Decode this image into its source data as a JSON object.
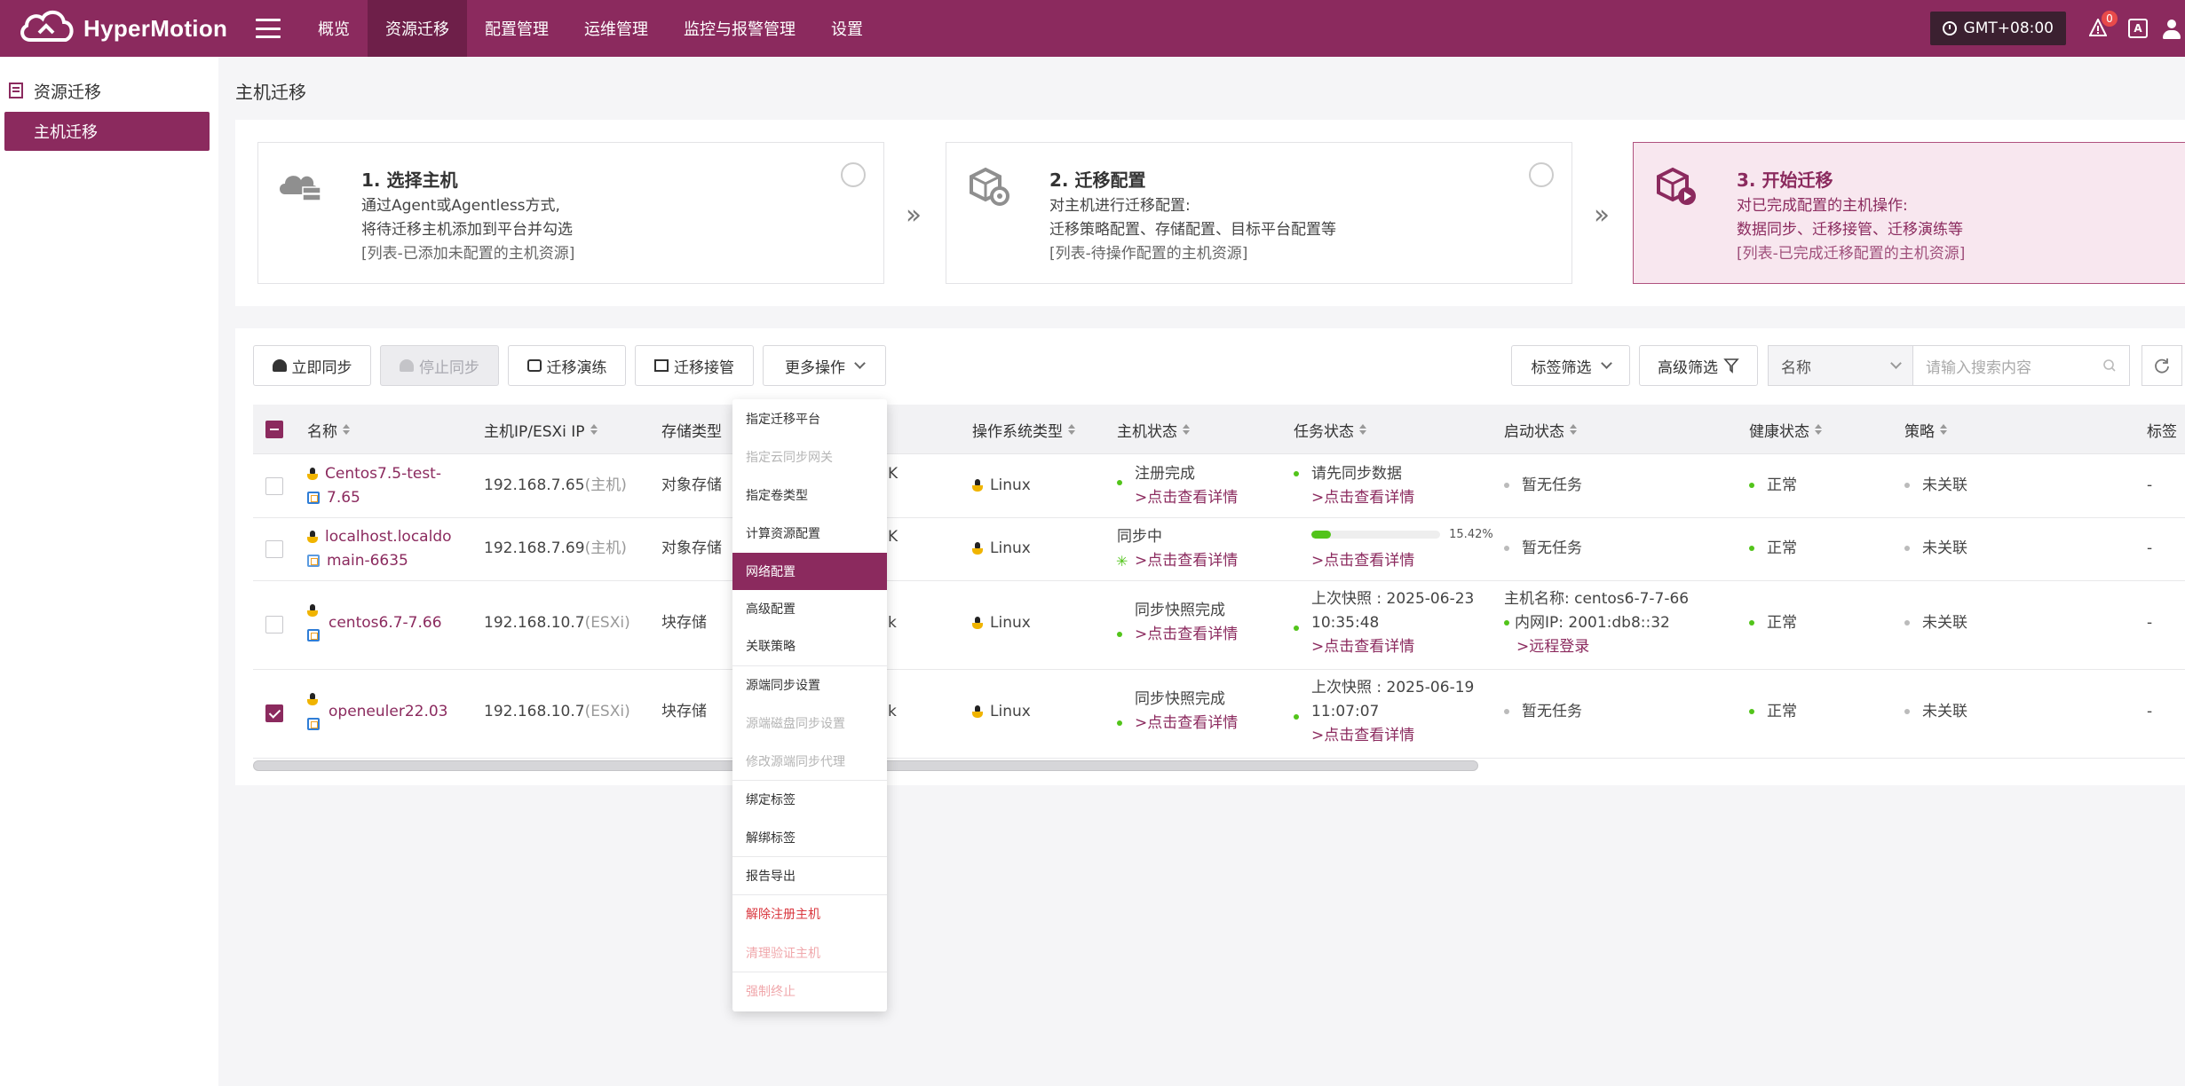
{
  "app": {
    "name": "HyperMotion"
  },
  "nav": {
    "items": [
      "概览",
      "资源迁移",
      "配置管理",
      "运维管理",
      "监控与报警管理",
      "设置"
    ],
    "active_index": 1
  },
  "header": {
    "timezone": "GMT+08:00",
    "alert_count": "0",
    "lang_label": "A"
  },
  "sidebar": {
    "title": "资源迁移",
    "items": [
      "主机迁移"
    ]
  },
  "page": {
    "title": "主机迁移"
  },
  "steps": [
    {
      "title": "1. 选择主机",
      "lines": [
        "通过Agent或Agentless方式,",
        "将待迁移主机添加到平台并勾选",
        "[列表-已添加未配置的主机资源]"
      ]
    },
    {
      "title": "2. 迁移配置",
      "lines": [
        "对主机进行迁移配置:",
        "迁移策略配置、存储配置、目标平台配置等",
        "[列表-待操作配置的主机资源]"
      ]
    },
    {
      "title": "3. 开始迁移",
      "lines": [
        "对已完成配置的主机操作:",
        "数据同步、迁移接管、迁移演练等",
        "[列表-已完成迁移配置的主机资源]"
      ]
    }
  ],
  "toolbar": {
    "sync_now": "立即同步",
    "stop_sync": "停止同步",
    "drill": "迁移演练",
    "takeover": "迁移接管",
    "more": "更多操作",
    "tag_filter": "标签筛选",
    "advanced_filter": "高级筛选",
    "search_field": "名称",
    "search_placeholder": "请输入搜索内容"
  },
  "table": {
    "columns": [
      "名称",
      "主机IP/ESXi IP",
      "存储类型",
      "操作系统类型",
      "主机状态",
      "任务状态",
      "启动状态",
      "健康状态",
      "策略",
      "标签"
    ],
    "rows": [
      {
        "name1": "Centos7.5-test-",
        "name2": "7.65",
        "ip": "192.168.7.65",
        "ip_suffix": "(主机)",
        "storage": "对象存储",
        "hidden_col": "K",
        "os": "Linux",
        "host_status": "注册完成",
        "host_link": ">点击查看详情",
        "task_line1": "请先同步数据",
        "task_link": ">点击查看详情",
        "boot": "暂无任务",
        "health": "正常",
        "policy": "未关联",
        "tag": "-",
        "checked": false
      },
      {
        "name1": "localhost.localdo",
        "name2": "main-6635",
        "ip": "192.168.7.69",
        "ip_suffix": "(主机)",
        "storage": "对象存储",
        "hidden_col": "K",
        "os": "Linux",
        "host_status": "同步中",
        "host_link": ">点击查看详情",
        "task_progress_label": "15.42%",
        "task_progress": 0.1542,
        "task_link": ">点击查看详情",
        "boot": "暂无任务",
        "health": "正常",
        "policy": "未关联",
        "tag": "-",
        "checked": false
      },
      {
        "name1": "centos6.7-7.66",
        "ip": "192.168.10.7",
        "ip_suffix": "(ESXi)",
        "storage": "块存储",
        "hidden_col": "k",
        "os": "Linux",
        "host_status": "同步快照完成",
        "host_link": ">点击查看详情",
        "task_line1": "上次快照 : 2025-06-23",
        "task_line2": "10:35:48",
        "task_link": ">点击查看详情",
        "boot_line1": "主机名称: centos6-7-7-66",
        "boot_line2": "内网IP: 2001:db8::32",
        "boot_link": ">远程登录",
        "health": "正常",
        "policy": "未关联",
        "tag": "-",
        "checked": false
      },
      {
        "name1": "openeuler22.03",
        "ip": "192.168.10.7",
        "ip_suffix": "(ESXi)",
        "storage": "块存储",
        "hidden_col": "k",
        "os": "Linux",
        "host_status": "同步快照完成",
        "host_link": ">点击查看详情",
        "task_line1": "上次快照 : 2025-06-19",
        "task_line2": "11:07:07",
        "task_link": ">点击查看详情",
        "boot": "暂无任务",
        "health": "正常",
        "policy": "未关联",
        "tag": "-",
        "checked": true
      }
    ]
  },
  "dropdown": {
    "items": [
      {
        "label": "指定迁移平台",
        "state": "normal"
      },
      {
        "label": "指定云同步网关",
        "state": "disabled"
      },
      {
        "label": "指定卷类型",
        "state": "normal"
      },
      {
        "label": "计算资源配置",
        "state": "normal"
      },
      {
        "label": "网络配置",
        "state": "active"
      },
      {
        "label": "高级配置",
        "state": "normal"
      },
      {
        "label": "关联策略",
        "state": "normal"
      },
      {
        "label": "源端同步设置",
        "state": "normal"
      },
      {
        "label": "源端磁盘同步设置",
        "state": "disabled"
      },
      {
        "label": "修改源端同步代理",
        "state": "disabled"
      },
      {
        "label": "绑定标签",
        "state": "normal"
      },
      {
        "label": "解绑标签",
        "state": "normal"
      },
      {
        "label": "报告导出",
        "state": "normal"
      },
      {
        "label": "解除注册主机",
        "state": "danger"
      },
      {
        "label": "清理验证主机",
        "state": "danger-disabled"
      },
      {
        "label": "强制终止",
        "state": "danger-disabled"
      }
    ]
  },
  "colors": {
    "brand": "#8b2a5e",
    "brand_dark": "#6e1f49",
    "success": "#52c41a",
    "danger": "#d9363e"
  }
}
